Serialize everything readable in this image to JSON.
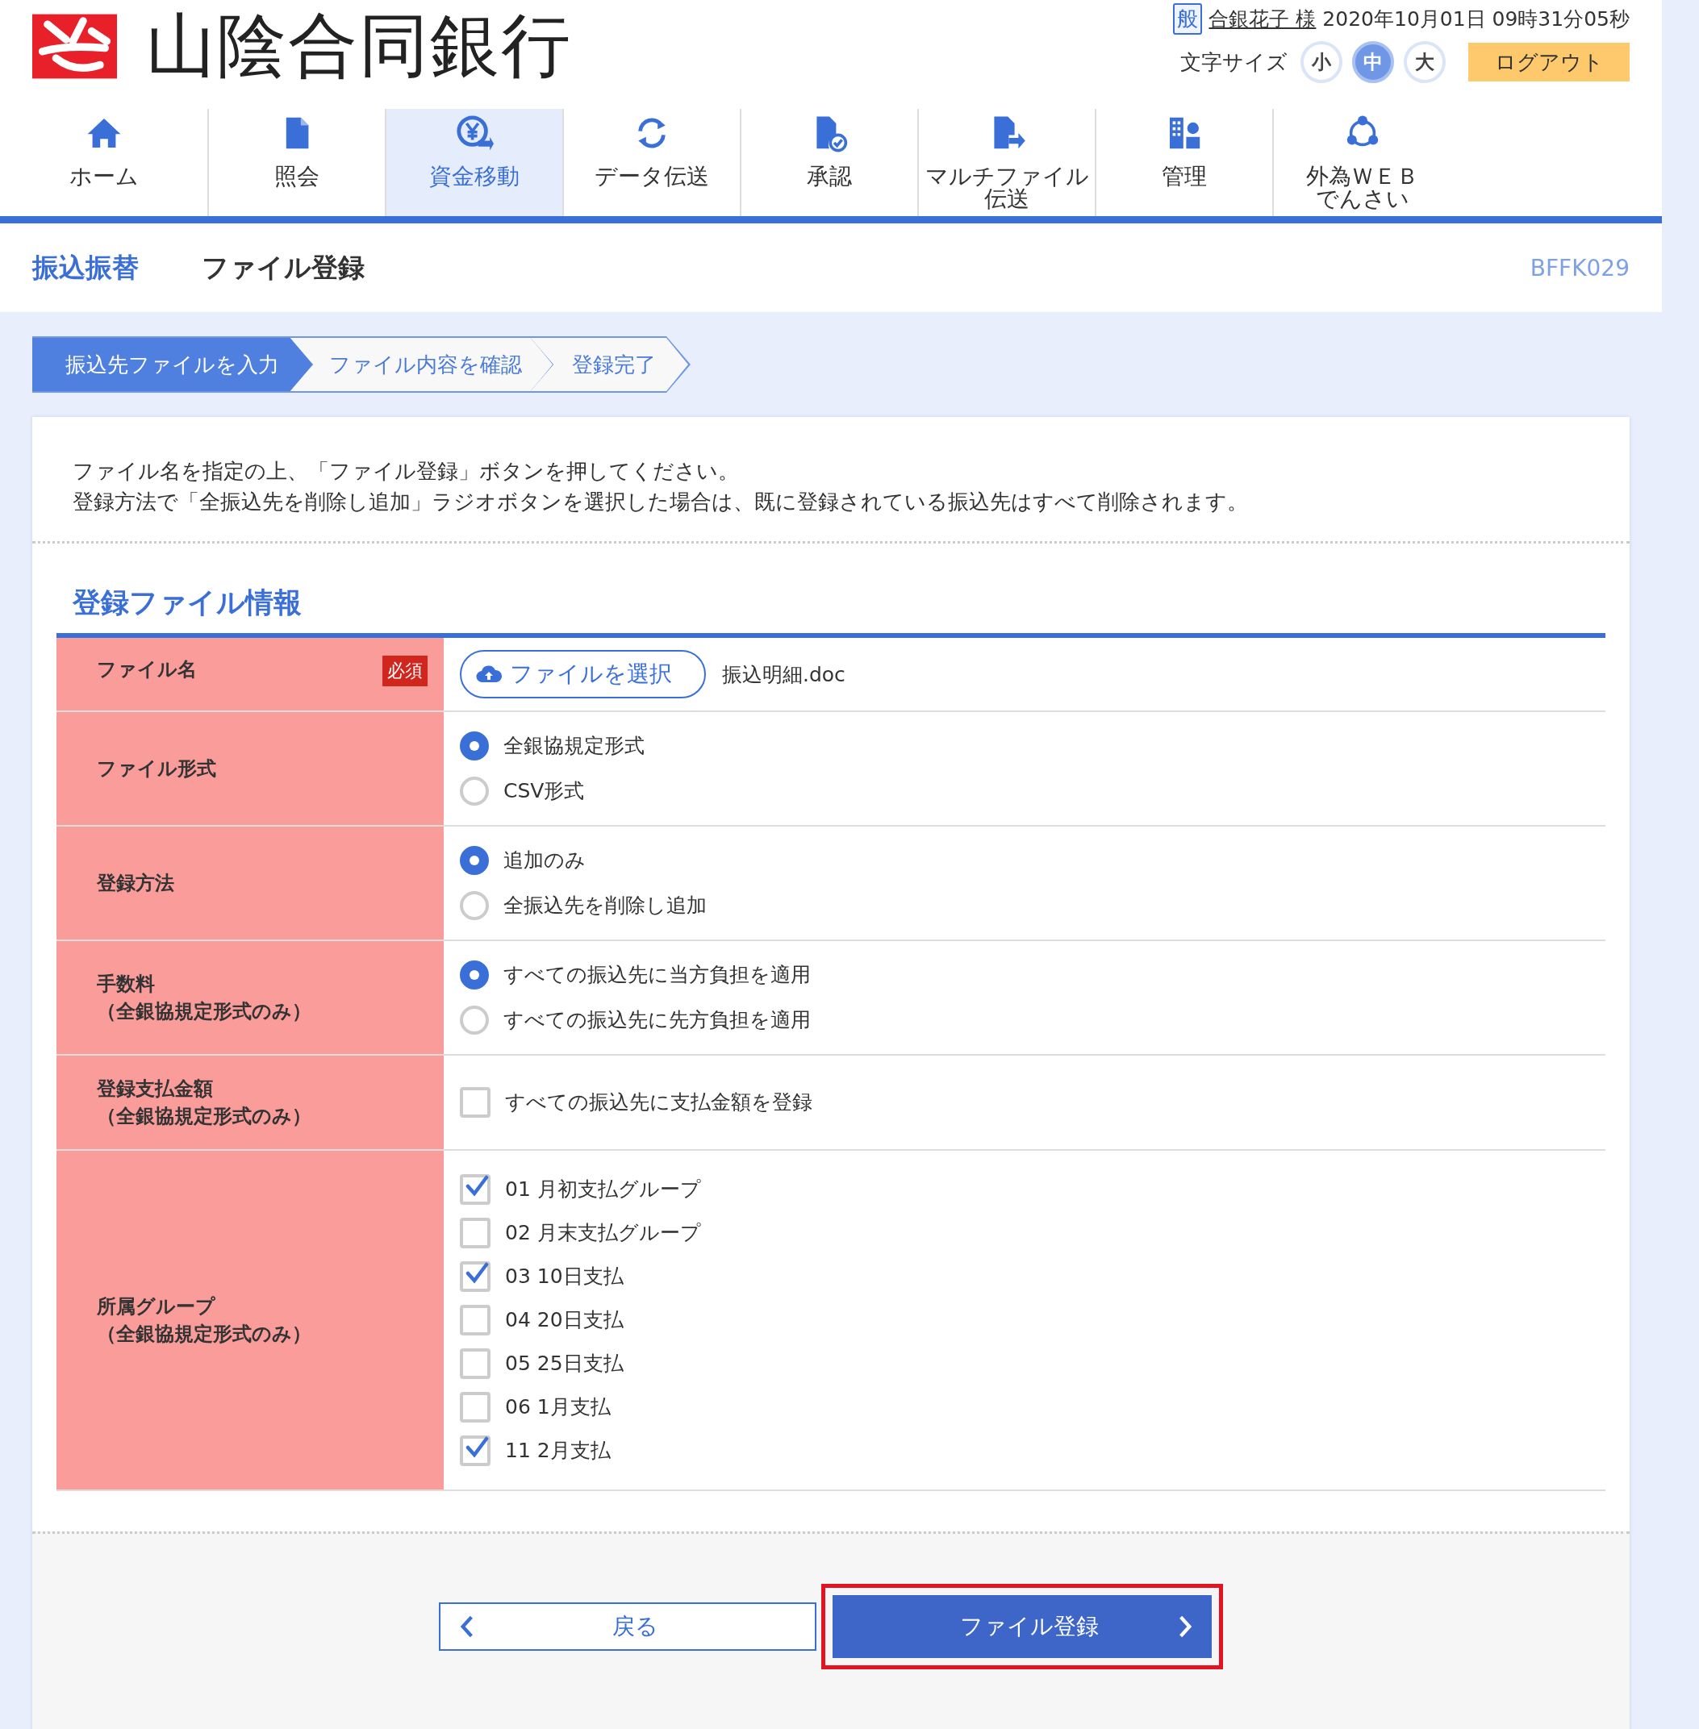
{
  "header": {
    "bank_name": "山陰合同銀行",
    "user_badge": "般",
    "user_name": "合銀花子 様",
    "datetime": "2020年10月01日 09時31分05秒",
    "font_size_label": "文字サイズ",
    "font_sizes": [
      {
        "label": "小",
        "selected": false
      },
      {
        "label": "中",
        "selected": true
      },
      {
        "label": "大",
        "selected": false
      }
    ],
    "logout": "ログアウト"
  },
  "nav": [
    {
      "lines": [
        "ホーム"
      ],
      "selected": false
    },
    {
      "lines": [
        "照会"
      ],
      "selected": false
    },
    {
      "lines": [
        "資金移動"
      ],
      "selected": true
    },
    {
      "lines": [
        "データ伝送"
      ],
      "selected": false
    },
    {
      "lines": [
        "承認"
      ],
      "selected": false
    },
    {
      "lines": [
        "マルチファイル",
        "伝送"
      ],
      "selected": false
    },
    {
      "lines": [
        "管理"
      ],
      "selected": false
    },
    {
      "lines": [
        "外為ＷＥＢ",
        "でんさい"
      ],
      "selected": false
    }
  ],
  "page_header": {
    "category": "振込振替",
    "title": "ファイル登録",
    "screen_id": "BFFK029"
  },
  "steps": [
    {
      "label": "振込先ファイルを入力",
      "selected": true
    },
    {
      "label": "ファイル内容を確認",
      "selected": false
    },
    {
      "label": "登録完了",
      "selected": false
    }
  ],
  "instructions": [
    "ファイル名を指定の上、「ファイル登録」ボタンを押してください。",
    "登録方法で「全振込先を削除し追加」ラジオボタンを選択した場合は、既に登録されている振込先はすべて削除されます。"
  ],
  "form": {
    "heading": "登録ファイル情報",
    "rows": [
      {
        "kind": "file",
        "label_lines": [
          "ファイル名"
        ],
        "required_badge": "必須",
        "button": "ファイルを選択",
        "file_name": "振込明細.doc"
      },
      {
        "kind": "radio",
        "label_lines": [
          "ファイル形式"
        ],
        "options": [
          {
            "label": "全銀協規定形式",
            "selected": true
          },
          {
            "label": "CSV形式",
            "selected": false
          }
        ]
      },
      {
        "kind": "radio",
        "label_lines": [
          "登録方法"
        ],
        "options": [
          {
            "label": "追加のみ",
            "selected": true
          },
          {
            "label": "全振込先を削除し追加",
            "selected": false
          }
        ]
      },
      {
        "kind": "radio",
        "label_lines": [
          "手数料",
          "（全銀協規定形式のみ）"
        ],
        "options": [
          {
            "label": "すべての振込先に当方負担を適用",
            "selected": true
          },
          {
            "label": "すべての振込先に先方負担を適用",
            "selected": false
          }
        ]
      },
      {
        "kind": "checkbox",
        "label_lines": [
          "登録支払金額",
          "（全銀協規定形式のみ）"
        ],
        "options": [
          {
            "label": "すべての振込先に支払金額を登録",
            "checked": false
          }
        ]
      },
      {
        "kind": "checkbox",
        "label_lines": [
          "所属グループ",
          "（全銀協規定形式のみ）"
        ],
        "options": [
          {
            "label": "01 月初支払グループ",
            "checked": true
          },
          {
            "label": "02 月末支払グループ",
            "checked": false
          },
          {
            "label": "03 10日支払",
            "checked": true
          },
          {
            "label": "04 20日支払",
            "checked": false
          },
          {
            "label": "05 25日支払",
            "checked": false
          },
          {
            "label": "06 1月支払",
            "checked": false
          },
          {
            "label": "11 2月支払",
            "checked": true
          }
        ]
      }
    ]
  },
  "buttons": {
    "back": "戻る",
    "submit": "ファイル登録",
    "submit_highlighted": true
  }
}
